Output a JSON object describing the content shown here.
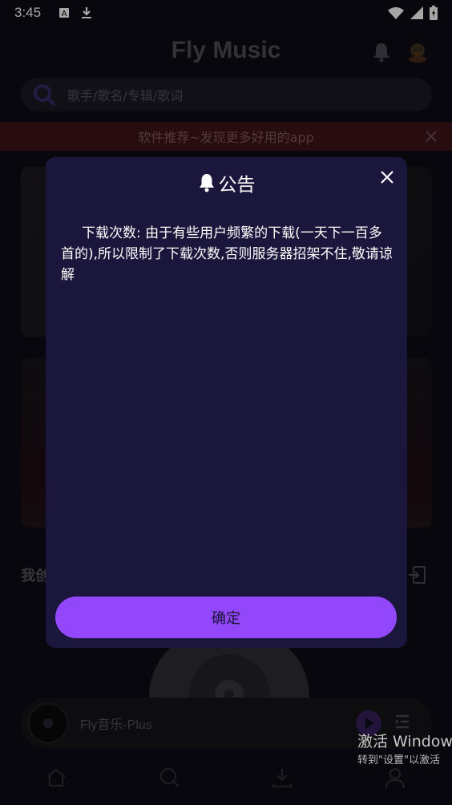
{
  "status_bar": {
    "time": "3:45"
  },
  "header": {
    "title": "Fly Music"
  },
  "search": {
    "placeholder": "歌手/歌名/专辑/歌词"
  },
  "promo": {
    "text": "软件推荐~发现更多好用的app"
  },
  "section": {
    "heading": "我创"
  },
  "player": {
    "track": "Fly音乐-Plus"
  },
  "watermark": {
    "line1": "激活 Window",
    "line2": "转到\"设置\"以激活"
  },
  "dialog": {
    "title": "公告",
    "body": "下载次数: 由于有些用户频繁的下载(一天下一百多首的),所以限制了下载次数,否则服务器招架不住,敬请谅解",
    "confirm_label": "确定"
  },
  "colors": {
    "accent": "#9247fa",
    "dialog_bg": "#1a163c",
    "app_bg": "#0c0b14",
    "promo_bg": "#3c1419"
  },
  "nav": {
    "items": [
      "home-icon",
      "search-icon",
      "download-icon",
      "profile-icon"
    ]
  }
}
